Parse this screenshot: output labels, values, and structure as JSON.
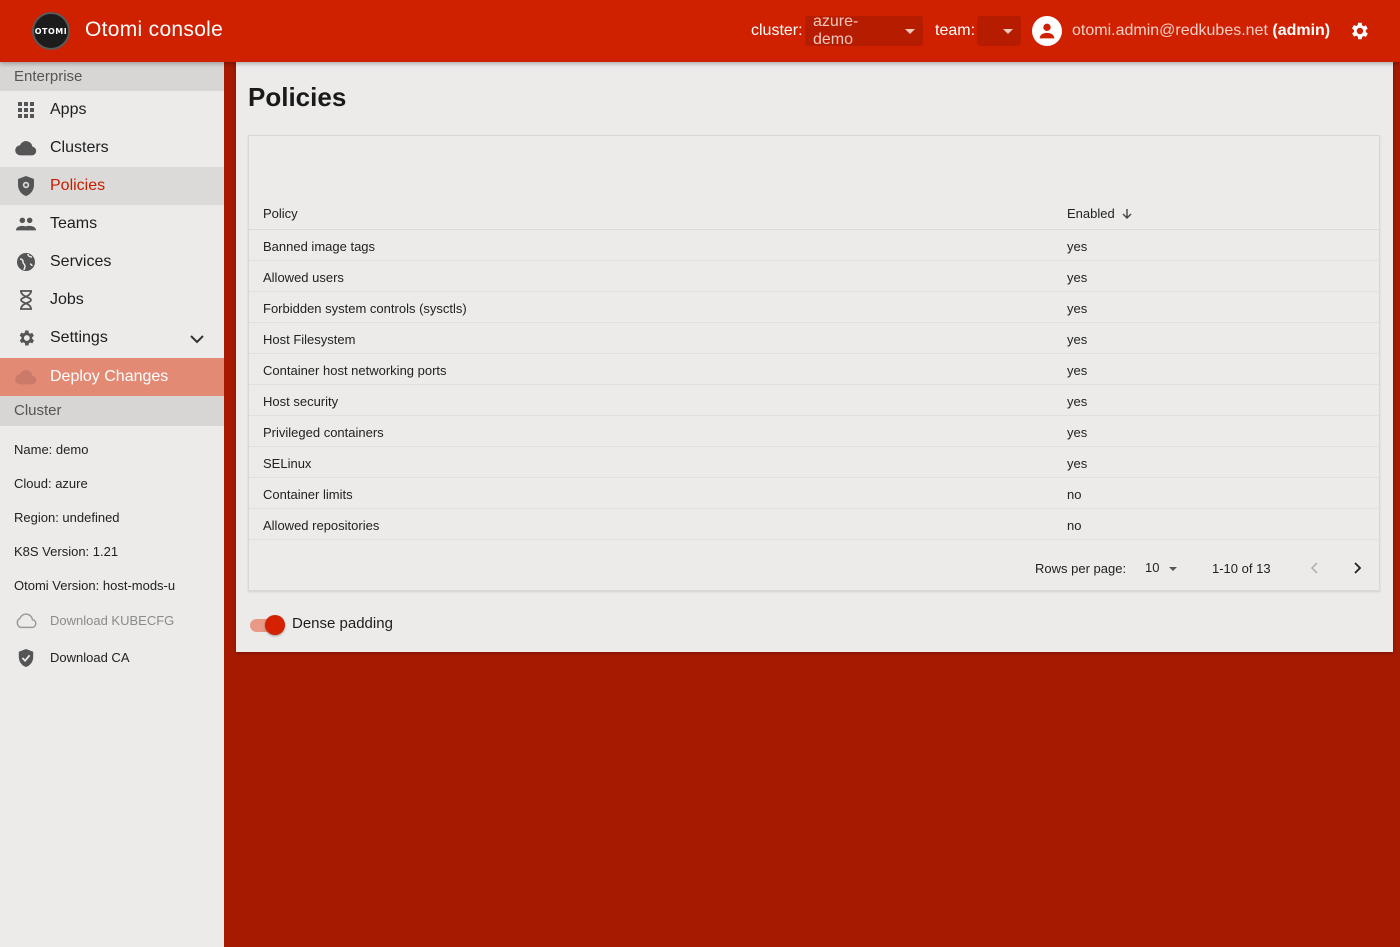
{
  "header": {
    "logo_text": "OTOMI",
    "app_title": "Otomi console",
    "cluster_label": "cluster:",
    "cluster_value": "azure-demo",
    "team_label": "team:",
    "team_value": "",
    "user_email": "otomi.admin@redkubes.net",
    "user_role": "(admin)",
    "accent_color": "#cf2000"
  },
  "sidebar": {
    "enterprise_heading": "Enterprise",
    "items": [
      {
        "label": "Apps",
        "icon": "apps-grid-icon"
      },
      {
        "label": "Clusters",
        "icon": "cloud-icon"
      },
      {
        "label": "Policies",
        "icon": "shield-lock-icon",
        "active": true
      },
      {
        "label": "Teams",
        "icon": "people-icon"
      },
      {
        "label": "Services",
        "icon": "globe-icon"
      },
      {
        "label": "Jobs",
        "icon": "hourglass-icon"
      },
      {
        "label": "Settings",
        "icon": "gear-icon"
      }
    ],
    "deploy_label": "Deploy Changes",
    "cluster_heading": "Cluster",
    "cluster_info": {
      "name": "Name: demo",
      "cloud": "Cloud: azure",
      "region": "Region: undefined",
      "k8s": "K8S Version: 1.21",
      "otomi": "Otomi Version: host-mods-u"
    },
    "download_kubecfg": "Download KUBECFG",
    "download_ca": "Download CA"
  },
  "main": {
    "title": "Policies",
    "columns": {
      "policy": "Policy",
      "enabled": "Enabled"
    },
    "rows": [
      {
        "policy": "Banned image tags",
        "enabled": "yes"
      },
      {
        "policy": "Allowed users",
        "enabled": "yes"
      },
      {
        "policy": "Forbidden system controls (sysctls)",
        "enabled": "yes"
      },
      {
        "policy": "Host Filesystem",
        "enabled": "yes"
      },
      {
        "policy": "Container host networking ports",
        "enabled": "yes"
      },
      {
        "policy": "Host security",
        "enabled": "yes"
      },
      {
        "policy": "Privileged containers",
        "enabled": "yes"
      },
      {
        "policy": "SELinux",
        "enabled": "yes"
      },
      {
        "policy": "Container limits",
        "enabled": "no"
      },
      {
        "policy": "Allowed repositories",
        "enabled": "no"
      }
    ],
    "pagination": {
      "rows_per_page_label": "Rows per page:",
      "rows_per_page": "10",
      "range": "1-10 of 13"
    },
    "dense_padding_label": "Dense padding",
    "dense_padding_on": true
  }
}
